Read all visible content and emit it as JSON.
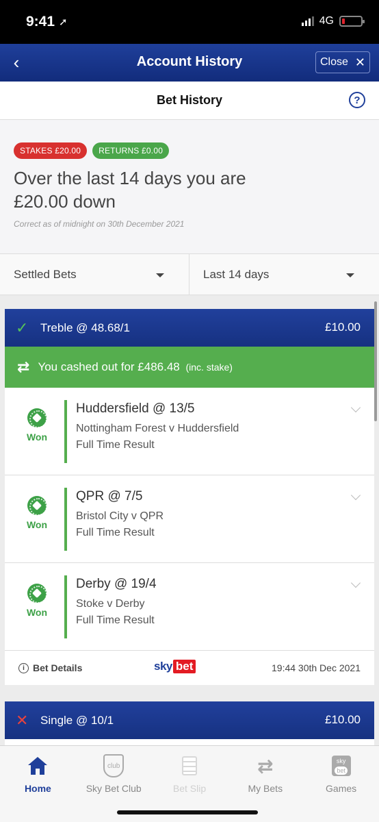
{
  "status": {
    "time": "9:41",
    "network": "4G"
  },
  "header": {
    "title": "Account History",
    "close_label": "Close"
  },
  "subheader": {
    "title": "Bet History"
  },
  "summary": {
    "stakes_badge": "STAKES £20.00",
    "returns_badge": "RETURNS £0.00",
    "line1": "Over the last 14 days you are",
    "line2": "£20.00 down",
    "note": "Correct as of midnight on 30th December 2021"
  },
  "filters": {
    "type": "Settled Bets",
    "period": "Last 14 days"
  },
  "bet1": {
    "title": "Treble @ 48.68/1",
    "stake": "£10.00",
    "cashout_text": "You cashed out for £486.48",
    "cashout_suffix": "(inc. stake)",
    "legs": [
      {
        "status": "Won",
        "selection": "Huddersfield @ 13/5",
        "event": "Nottingham Forest v Huddersfield",
        "market": "Full Time Result"
      },
      {
        "status": "Won",
        "selection": "QPR @ 7/5",
        "event": "Bristol City v QPR",
        "market": "Full Time Result"
      },
      {
        "status": "Won",
        "selection": "Derby @ 19/4",
        "event": "Stoke v Derby",
        "market": "Full Time Result"
      }
    ],
    "details_label": "Bet Details",
    "logo_sky": "sky",
    "logo_bet": "bet",
    "timestamp": "19:44 30th Dec 2021"
  },
  "bet2": {
    "title": "Single @ 10/1",
    "stake": "£10.00"
  },
  "tabs": [
    {
      "label": "Home",
      "icon": "home-icon"
    },
    {
      "label": "Sky Bet Club",
      "icon": "club-shield-icon",
      "icon_text": "club"
    },
    {
      "label": "Bet Slip",
      "icon": "bet-slip-icon"
    },
    {
      "label": "My Bets",
      "icon": "my-bets-icon"
    },
    {
      "label": "Games",
      "icon": "games-icon",
      "icon_text_top": "sky",
      "icon_text_bottom": "bet"
    }
  ],
  "colors": {
    "brand_blue": "#1f3f9a",
    "won_green": "#3da147",
    "stakes_red": "#d8312f"
  }
}
